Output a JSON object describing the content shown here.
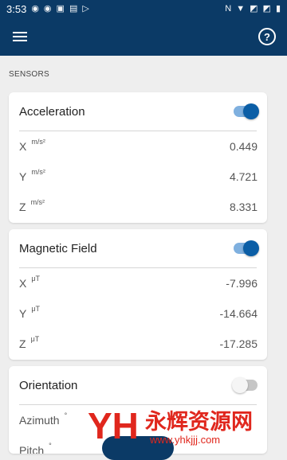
{
  "status_bar": {
    "time": "3:53"
  },
  "app_bar": {
    "menu_icon": "menu-icon",
    "help_icon": "help-icon"
  },
  "section_title": "SENSORS",
  "cards": {
    "acceleration": {
      "title": "Acceleration",
      "enabled": true,
      "rows": [
        {
          "axis": "X",
          "unit": "m/s²",
          "value": "0.449"
        },
        {
          "axis": "Y",
          "unit": "m/s²",
          "value": "4.721"
        },
        {
          "axis": "Z",
          "unit": "m/s²",
          "value": "8.331"
        }
      ]
    },
    "magnetic": {
      "title": "Magnetic Field",
      "enabled": true,
      "rows": [
        {
          "axis": "X",
          "unit": "μT",
          "value": "-7.996"
        },
        {
          "axis": "Y",
          "unit": "μT",
          "value": "-14.664"
        },
        {
          "axis": "Z",
          "unit": "μT",
          "value": "-17.285"
        }
      ]
    },
    "orientation": {
      "title": "Orientation",
      "enabled": false,
      "rows": [
        {
          "axis": "Azimuth",
          "unit": "°",
          "value": ""
        },
        {
          "axis": "Pitch",
          "unit": "°",
          "value": ""
        }
      ]
    }
  },
  "colors": {
    "primary": "#0b3a66",
    "toggle_on": "#0b5ea6",
    "toggle_track_on": "#7fb0df"
  },
  "watermark": {
    "text": "永辉资源网",
    "url": "www.yhkjjj.com"
  }
}
